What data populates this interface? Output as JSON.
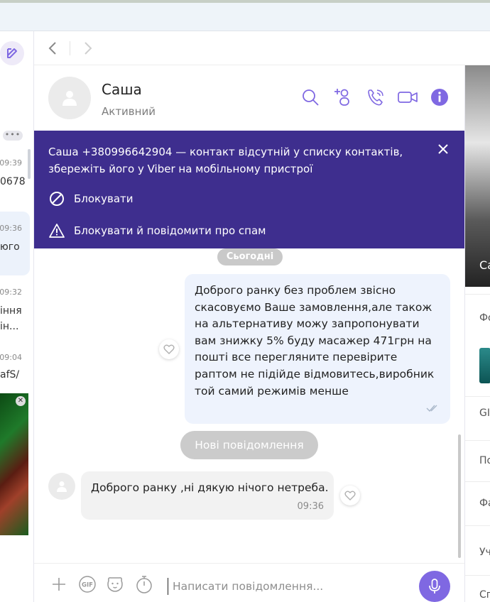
{
  "sidebar": {
    "rows": [
      {
        "time": "09:39",
        "text": "0678"
      },
      {
        "time": "09:36",
        "text": "юго"
      },
      {
        "time": "09:32",
        "text": "іння",
        "text2": "ін..."
      },
      {
        "time": "09:04",
        "text": "afS/"
      }
    ]
  },
  "contact": {
    "name": "Саша",
    "status": "Активний"
  },
  "banner": {
    "message": "Саша +380996642904 — контакт відсутній у списку контактів, збережіть його у Viber на мобільному пристрої",
    "block_label": "Блокувати",
    "block_spam_label": "Блокувати й повідомити про спам"
  },
  "chat": {
    "date_label": "Сьогодні",
    "outgoing_text": "Доброго ранку без проблем звісно скасовуємо Ваше замовлення,але також на альтернативу можу запропонувати вам знижку 5% буду масажер 471грн на пошті все перегляните перевірите раптом не підійде відмовитесь,виробник той самий режимів менше",
    "new_messages_label": "Нові повідомлення",
    "incoming_text": "Доброго ранку ,ні дякую нічого нетреба.",
    "incoming_time": "09:36"
  },
  "composer": {
    "placeholder": "Написати повідомлення..."
  },
  "right_panel": {
    "image_label": "Са",
    "labels": [
      "Фо",
      "GI",
      "По",
      "Фа",
      "Уч",
      "Сп"
    ]
  },
  "colors": {
    "accent": "#7f68e2",
    "banner_bg": "#3e2e8e",
    "outgoing_bubble": "#eef3fd",
    "incoming_bubble": "#f2f2f2"
  }
}
